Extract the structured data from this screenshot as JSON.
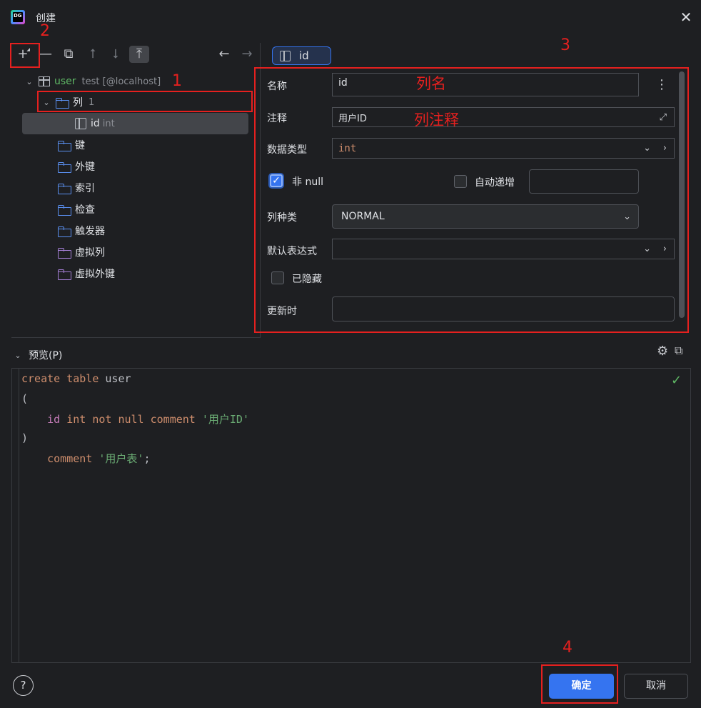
{
  "window": {
    "logo_text": "DG",
    "title": "创建",
    "close_glyph": "✕"
  },
  "toolbar": {
    "add_glyph": "+",
    "remove_glyph": "—",
    "copy_glyph": "⧉",
    "move_up_glyph": "⭡",
    "move_down_glyph": "⭣",
    "move_top_glyph": "⤒",
    "back_glyph": "←",
    "forward_glyph": "→"
  },
  "tree": {
    "table_name": "user",
    "table_meta": "test [@localhost]",
    "columns_label": "列",
    "columns_count": "1",
    "column_name": "id",
    "column_type": "int",
    "folders": [
      "键",
      "外键",
      "索引",
      "检查",
      "触发器"
    ],
    "virtual_folders": [
      "虚拟列",
      "虚拟外键"
    ]
  },
  "editor": {
    "tab_label": "id",
    "name_label": "名称",
    "name_value": "id",
    "comment_label": "注释",
    "comment_value": "用户ID",
    "datatype_label": "数据类型",
    "datatype_value": "int",
    "notnull_label": "非 null",
    "notnull_checked": true,
    "autoinc_label": "自动递增",
    "autoinc_checked": false,
    "coltype_label": "列种类",
    "coltype_value": "NORMAL",
    "default_label": "默认表达式",
    "default_value": "",
    "hidden_label": "已隐藏",
    "hidden_checked": false,
    "onupdate_label": "更新时",
    "onupdate_value": ""
  },
  "preview": {
    "header_label": "预览(P)",
    "code": {
      "l1_kw": "create table",
      "l1_name": " user",
      "l2": "(",
      "l3_id": "id",
      "l3_kw": " int not null comment ",
      "l3_str": "'用户ID'",
      "l4": ")",
      "l5_kw": "comment ",
      "l5_str": "'用户表'",
      "l5_end": ";"
    },
    "status_glyph": "✓"
  },
  "footer": {
    "help_glyph": "?",
    "ok_label": "确定",
    "cancel_label": "取消"
  },
  "annotations": {
    "n1": "1",
    "n2": "2",
    "n3": "3",
    "n4": "4",
    "label_colname": "列名",
    "label_colcomment": "列注释"
  },
  "colors": {
    "accent": "#3574f0",
    "annotation": "#e5201f",
    "background": "#1e1f22"
  }
}
